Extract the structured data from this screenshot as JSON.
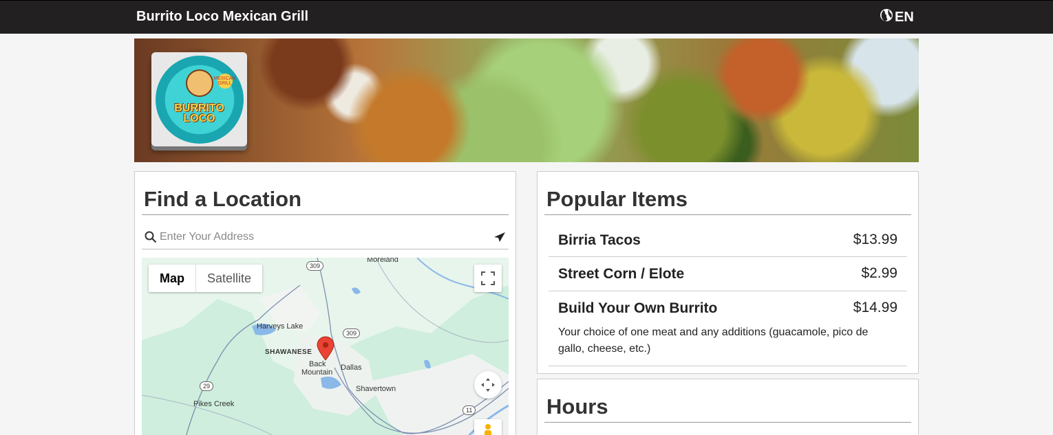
{
  "navbar": {
    "brand": "Burrito Loco Mexican Grill",
    "language": "EN"
  },
  "logo": {
    "line1": "BURRITO",
    "line2": "LOCO",
    "badge": "MEXICAN GRILL"
  },
  "location": {
    "title": "Find a Location",
    "search_placeholder": "Enter Your Address",
    "map": {
      "map_tab": "Map",
      "satellite_tab": "Satellite",
      "labels": {
        "moreland": "Moreland",
        "harveys_lake": "Harveys Lake",
        "shawanese": "SHAWANESE",
        "back_mountain_1": "Back",
        "back_mountain_2": "Mountain",
        "dallas": "Dallas",
        "shavertown": "Shavertown",
        "pikes_creek": "Pikes Creek",
        "r309a": "309",
        "r309b": "309",
        "r29": "29",
        "r11": "11"
      }
    }
  },
  "popular": {
    "title": "Popular Items",
    "items": [
      {
        "name": "Birria Tacos",
        "price": "$13.99"
      },
      {
        "name": "Street Corn / Elote",
        "price": "$2.99"
      },
      {
        "name": "Build Your Own Burrito",
        "price": "$14.99",
        "description": "Your choice of one meat and any additions (guacamole, pico de gallo, cheese, etc.)"
      }
    ]
  },
  "hours": {
    "title": "Hours"
  }
}
